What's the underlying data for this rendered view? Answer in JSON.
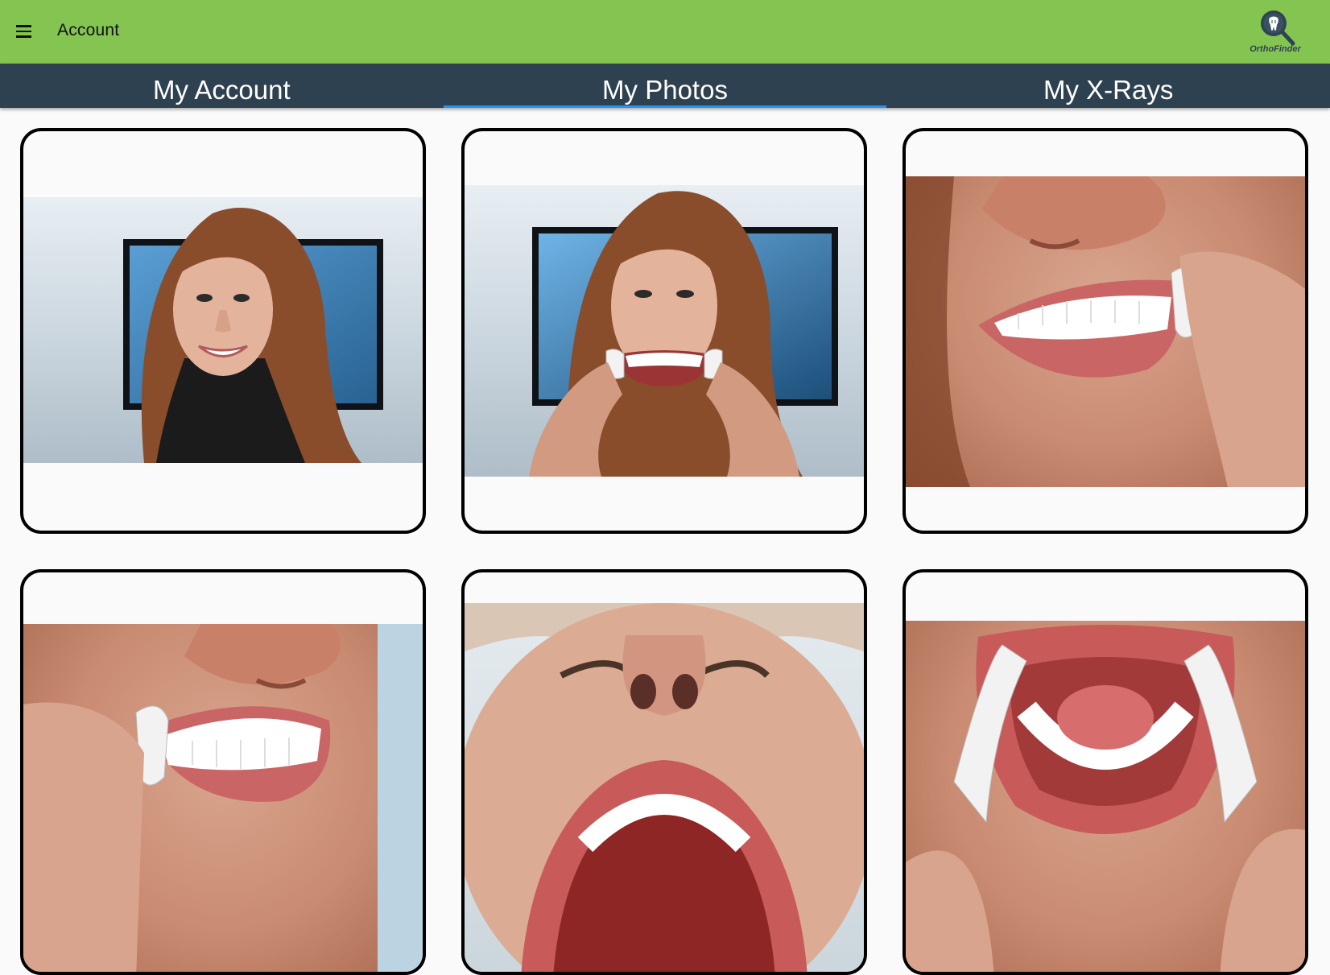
{
  "appbar": {
    "title": "Account",
    "menu_icon": "hamburger-menu-icon",
    "logo_text": "OrthoFinder",
    "logo_icon": "tooth-magnifier-icon",
    "color": "#84c552"
  },
  "tabs": [
    {
      "label": "My Account",
      "active": false
    },
    {
      "label": "My Photos",
      "active": true
    },
    {
      "label": "My X-Rays",
      "active": false
    }
  ],
  "tabbar_color": "#2e4150",
  "active_indicator_color": "#2196f3",
  "photos": [
    {
      "name": "smile-front"
    },
    {
      "name": "retracted-front"
    },
    {
      "name": "retracted-right"
    },
    {
      "name": "retracted-left"
    },
    {
      "name": "upper-occlusal"
    },
    {
      "name": "lower-occlusal"
    }
  ]
}
